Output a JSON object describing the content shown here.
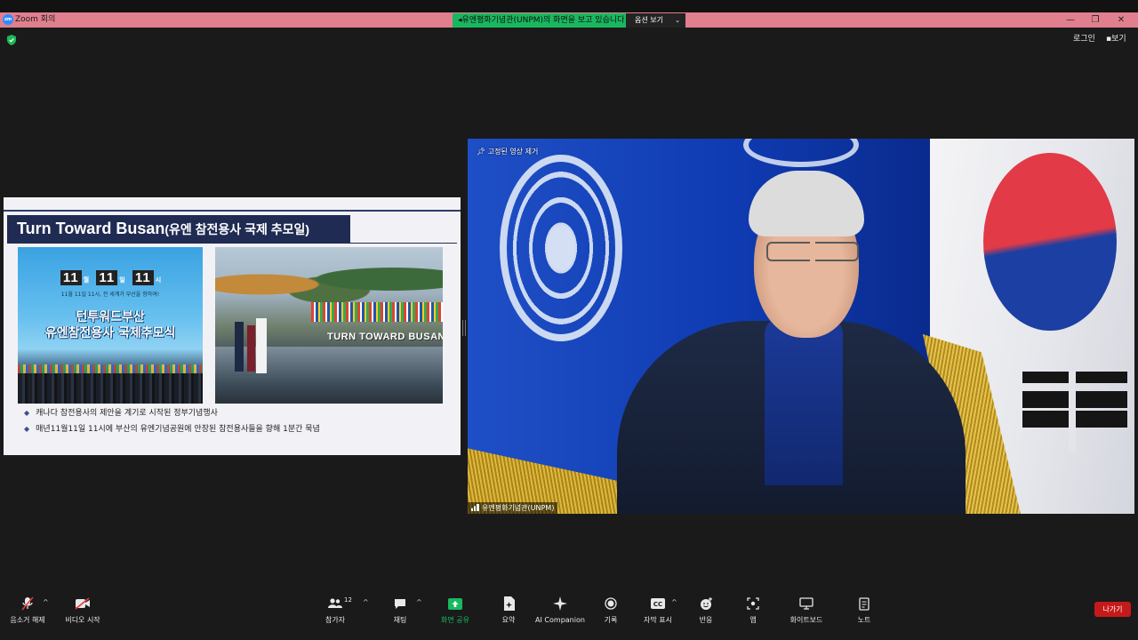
{
  "window": {
    "title": "Zoom 회의",
    "logo_text": "zm",
    "share_banner": "유엔평화기념관(UNPM)의 화면을 보고 있습니다",
    "options_label": "옵션 보기",
    "controls": [
      "—",
      "❐",
      "✕"
    ]
  },
  "top_right": {
    "signin_label": "로그인",
    "view_label": "보기"
  },
  "slide": {
    "title": "Turn Toward Busan",
    "title_suffix": "(유엔 참전용사 국제 추모일)",
    "poster": {
      "n1": "11",
      "u1": "월",
      "n2": "11",
      "u2": "일",
      "n3": "11",
      "u3": "시",
      "subtitle": "11월 11일 11시, 전 세계가 부산을 향하여!",
      "line1": "턴투워드부산",
      "line2": "유엔참전용사 국제추모식"
    },
    "photo_sign": "TURN TOWARD BUSAN",
    "bullets": [
      "캐나다 참전용사의 제안을 계기로 시작된 정부기념행사",
      "매년11월11일 11시에 부산의 유엔기념공원에 안장된 참전용사들을 향해 1분간 묵념"
    ]
  },
  "video": {
    "pinned_label": "고정된 영상 제거",
    "participant_name": "유엔평화기념관(UNPM)"
  },
  "toolbar": {
    "mute_label": "음소거 해제",
    "video_label": "비디오 시작",
    "participants_label": "참가자",
    "participants_count": "12",
    "chat_label": "채팅",
    "share_label": "화면 공유",
    "summary_label": "요약",
    "ai_label": "AI Companion",
    "record_label": "기록",
    "captions_label": "자막 표시",
    "reactions_label": "반응",
    "apps_label": "앱",
    "whiteboard_label": "화이트보드",
    "notes_label": "노트",
    "leave_label": "나가기"
  },
  "colors": {
    "share_green": "#19b85f",
    "leave_red": "#c51a1a",
    "slide_navy": "#1f2b52",
    "titlebar_pink": "#e07f8e"
  }
}
